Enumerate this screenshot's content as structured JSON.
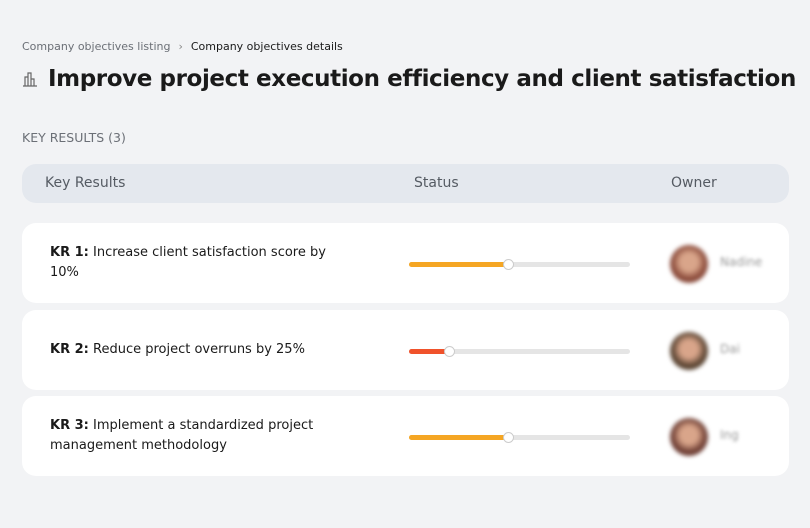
{
  "breadcrumb": {
    "parent": "Company objectives listing",
    "current": "Company objectives details"
  },
  "title": "Improve project execution efficiency and client satisfaction",
  "section_label": "KEY RESULTS (3)",
  "table": {
    "headers": [
      "Key Results",
      "Status",
      "Owner"
    ],
    "rows": [
      {
        "id": "KR 1:",
        "text": "Increase client satisfaction score by 10%",
        "progress": 45,
        "color": "#f5a623",
        "owner": "Nadine",
        "avatar_color": "#8a4a3a"
      },
      {
        "id": "KR 2:",
        "text": "Reduce project overruns by 25%",
        "progress": 18,
        "color": "#f0522b",
        "owner": "Dai",
        "avatar_color": "#5a4432"
      },
      {
        "id": "KR 3:",
        "text": "Implement a standardized project management methodology",
        "progress": 45,
        "color": "#f5a623",
        "owner": "Ing",
        "avatar_color": "#6e3e34"
      }
    ]
  }
}
